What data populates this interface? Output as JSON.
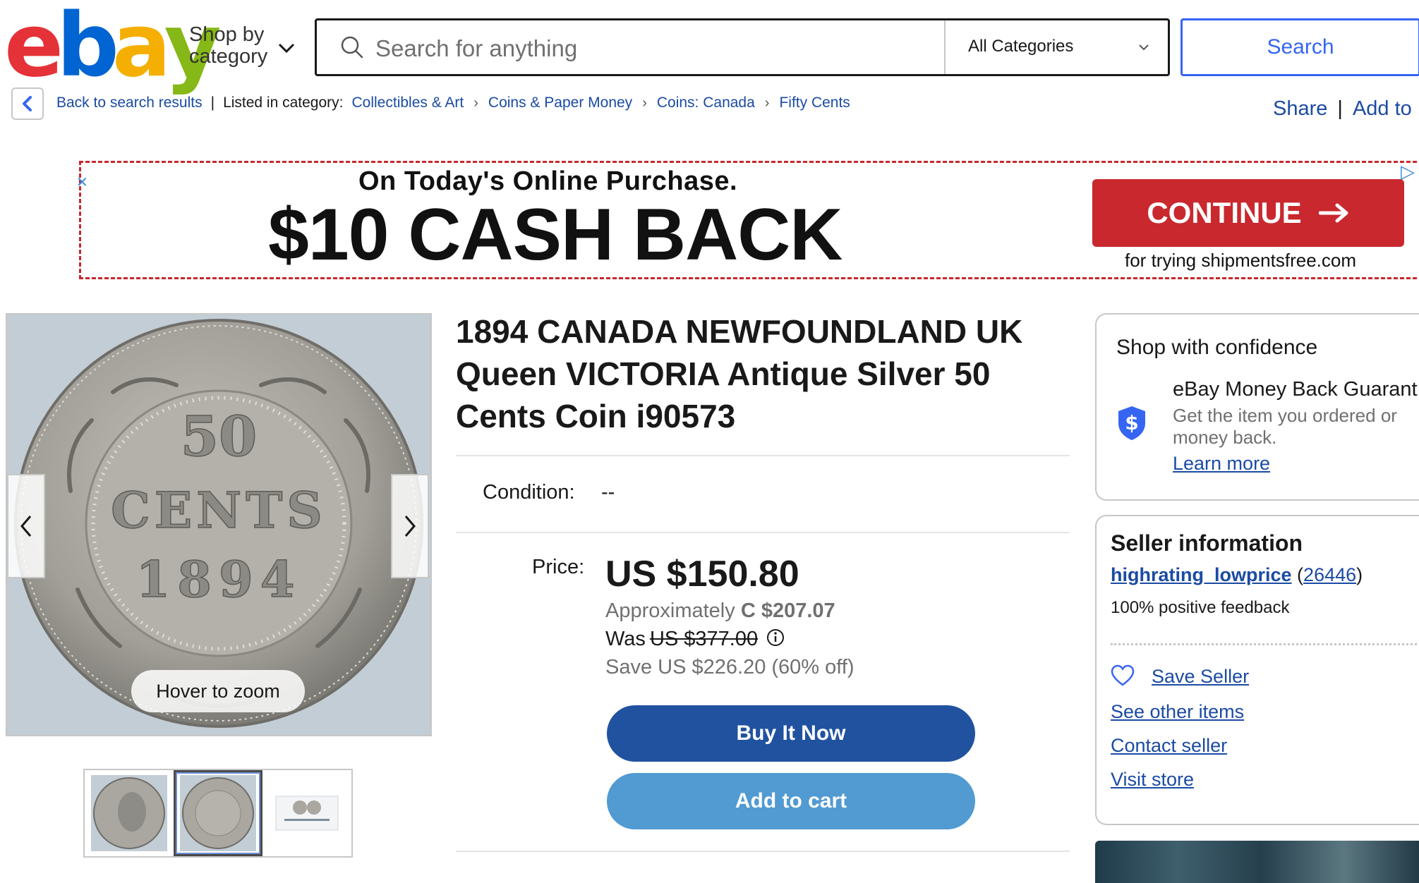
{
  "header": {
    "logo": {
      "letters": [
        "e",
        "b",
        "a",
        "y"
      ],
      "colors": [
        "#e53238",
        "#0064d2",
        "#f5af02",
        "#86b817"
      ]
    },
    "shop_by_category": [
      "Shop by",
      "category"
    ],
    "search": {
      "placeholder": "Search for anything",
      "value": ""
    },
    "category_select": "All Categories",
    "search_button": "Search"
  },
  "breadcrumb": {
    "back_label": "Back to search results",
    "listed_in": "Listed in category:",
    "items": [
      "Collectibles & Art",
      "Coins & Paper Money",
      "Coins: Canada",
      "Fifty Cents"
    ],
    "share": "Share",
    "add_to": "Add to"
  },
  "ad": {
    "subtitle": "On Today's Online Purchase.",
    "headline": "$10 CASH BACK",
    "cta": "CONTINUE",
    "footer": "for trying shipmentsfree.com"
  },
  "gallery": {
    "hover_label": "Hover to zoom",
    "coin_text": {
      "value": "50",
      "unit": "CENTS",
      "year": "1894"
    },
    "selected_thumbnail": 2,
    "thumbnail_count": 3
  },
  "listing": {
    "title": "1894 CANADA NEWFOUNDLAND UK Queen VICTORIA Antique Silver 50 Cents Coin i90573",
    "condition_label": "Condition:",
    "condition_value": "--",
    "price_label": "Price:",
    "price": "US $150.80",
    "approx_prefix": "Approximately",
    "approx_value": "C $207.07",
    "was_prefix": "Was",
    "was_value": "US $377.00",
    "save": "Save US $226.20 (60% off)",
    "buy_now": "Buy It Now",
    "add_to_cart": "Add to cart"
  },
  "confidence": {
    "title": "Shop with confidence",
    "guarantee_title": "eBay Money Back Guarant",
    "guarantee_desc_1": "Get the item you ordered or",
    "guarantee_desc_2": "money back.",
    "learn_more": "Learn more"
  },
  "seller": {
    "title": "Seller information",
    "name": "highrating_lowprice",
    "count_open": "(",
    "count": "26446",
    "count_close": ")",
    "feedback": "100% positive feedback",
    "save_seller": "Save Seller",
    "see_other": "See other items",
    "contact": "Contact seller",
    "visit_store": "Visit store"
  },
  "colors": {
    "link": "#1b4ba3",
    "buy_now_bg": "#2152a0",
    "add_to_cart_bg": "#519ad2",
    "ad_red": "#c8282e",
    "search_blue": "#3665f3"
  }
}
